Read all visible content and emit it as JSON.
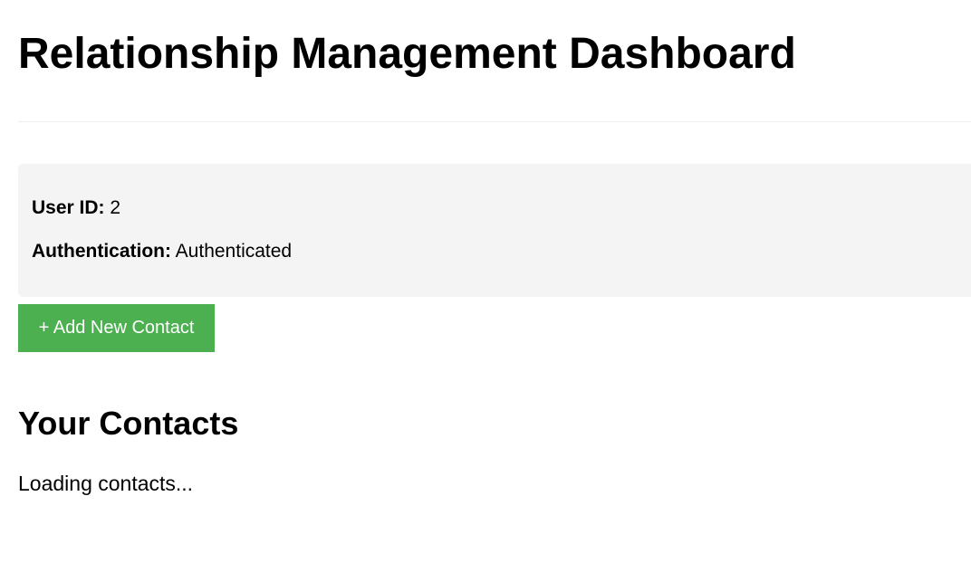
{
  "header": {
    "title": "Relationship Management Dashboard"
  },
  "user_info": {
    "user_id_label": "User ID:",
    "user_id_value": "2",
    "auth_label": "Authentication:",
    "auth_value": "Authenticated"
  },
  "actions": {
    "add_contact_label": "+ Add New Contact"
  },
  "contacts": {
    "heading": "Your Contacts",
    "status": "Loading contacts..."
  },
  "colors": {
    "accent_green": "#4caf50",
    "panel_bg": "#f4f4f4"
  }
}
